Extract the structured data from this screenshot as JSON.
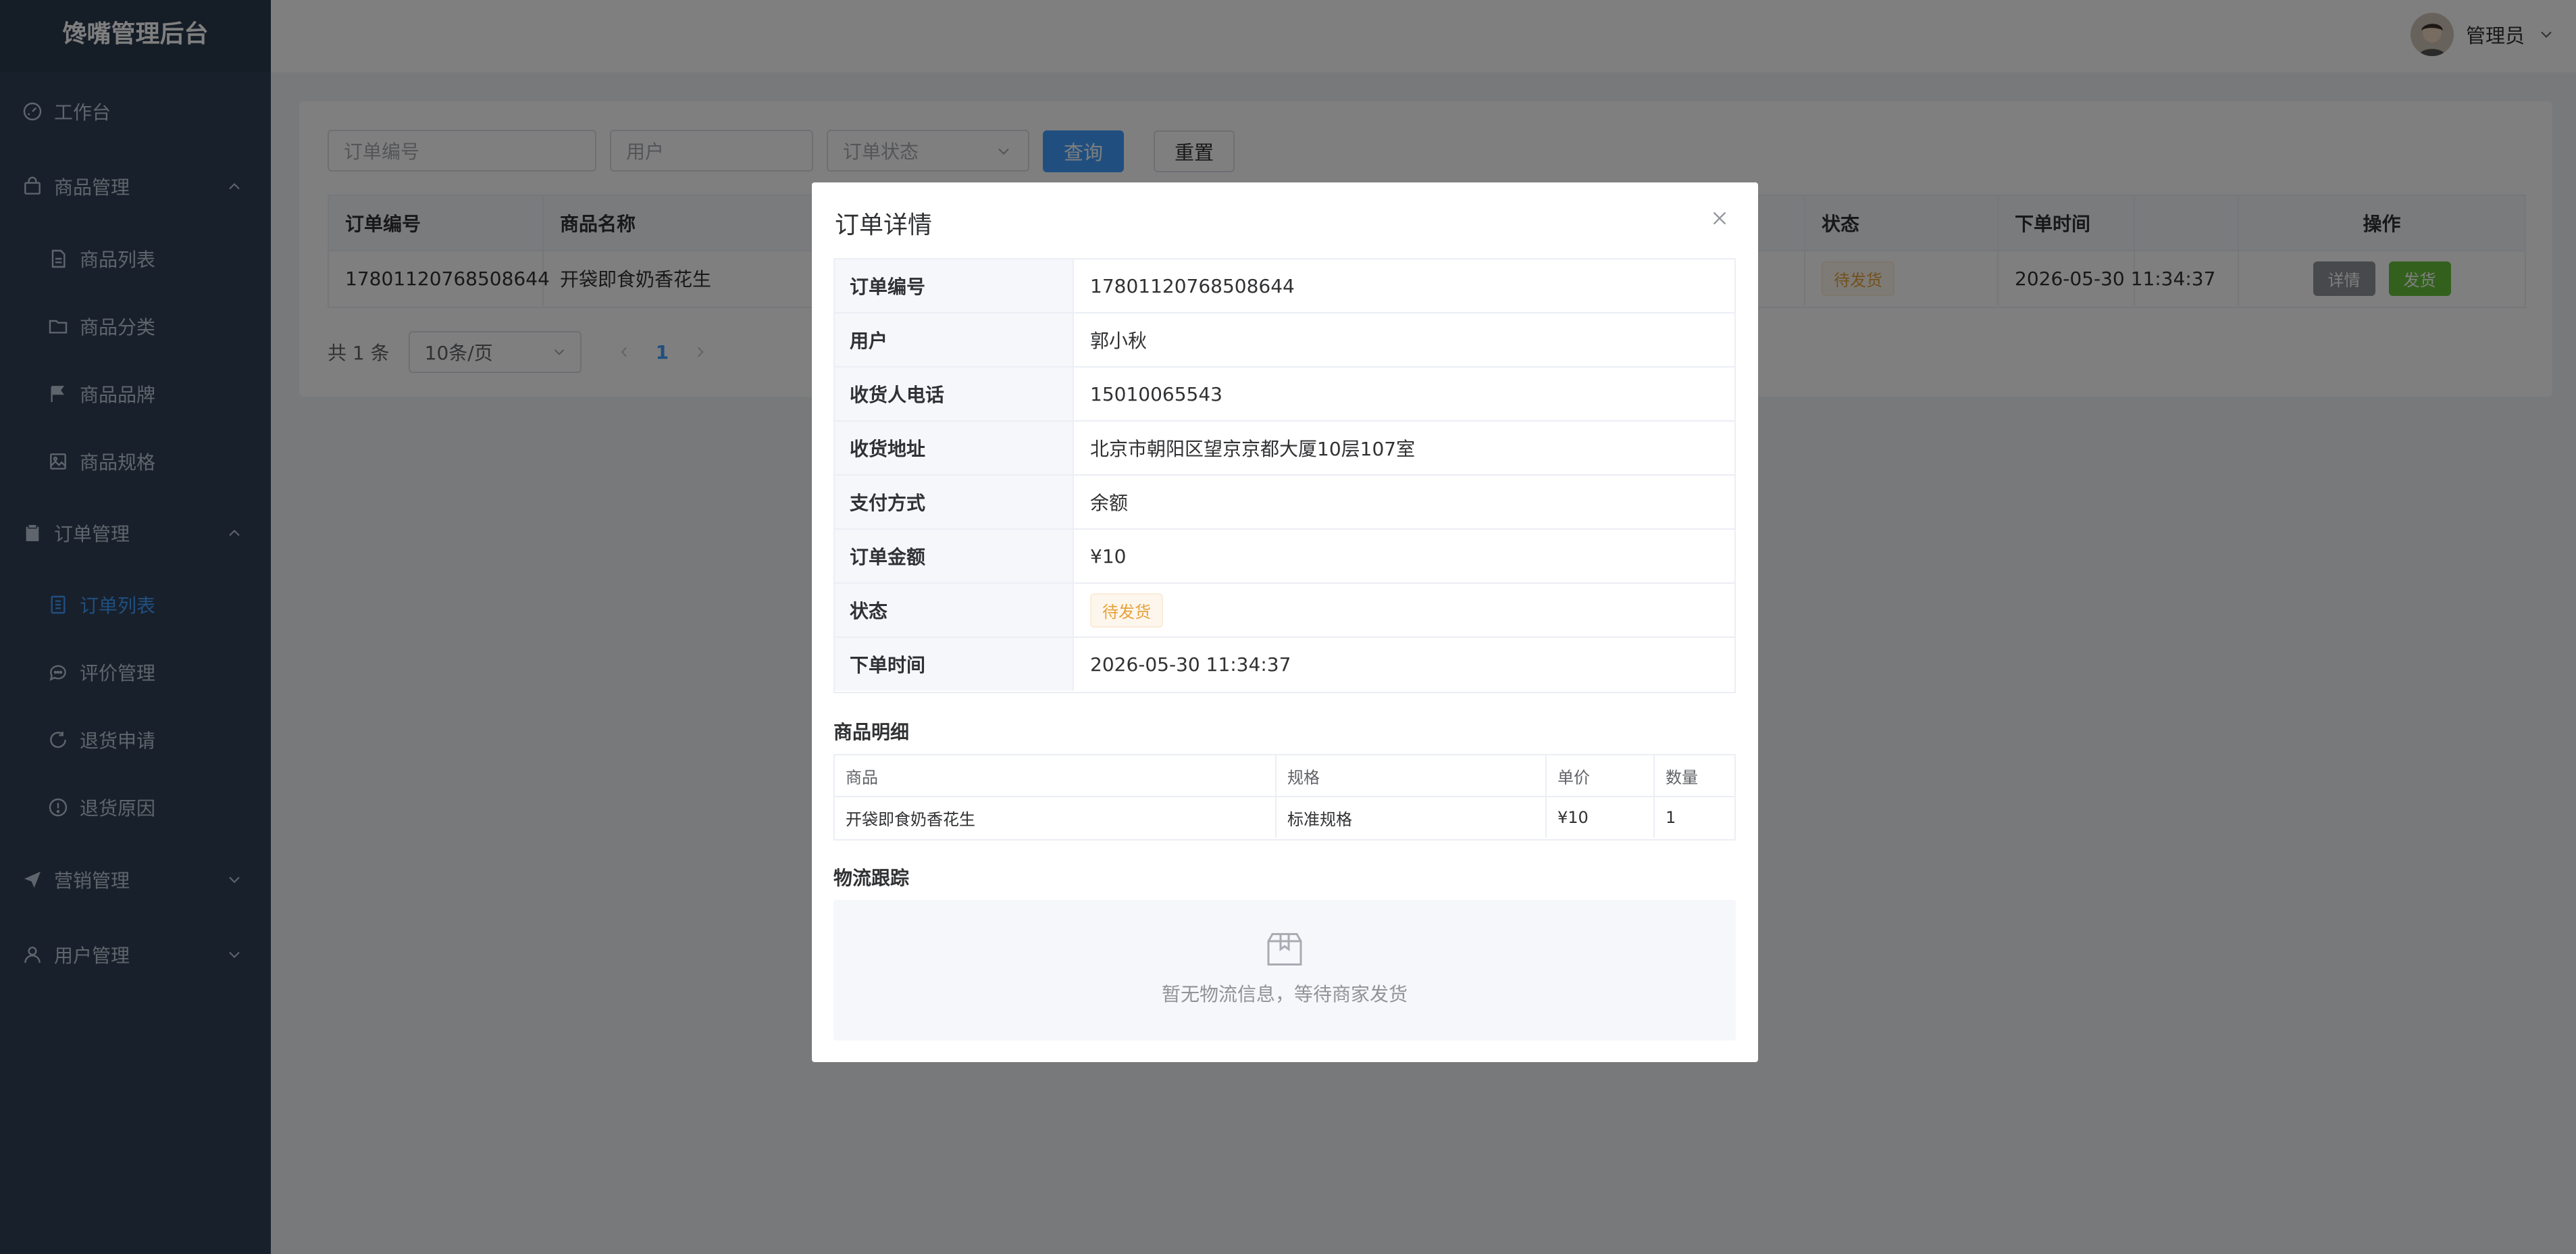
{
  "app": {
    "title": "馋嘴管理后台"
  },
  "sidebar": {
    "items": [
      {
        "label": "工作台",
        "icon": "dashboard-icon"
      },
      {
        "label": "商品管理",
        "icon": "bag-icon",
        "expanded": true
      },
      {
        "label": "商品列表",
        "icon": "document-icon"
      },
      {
        "label": "商品分类",
        "icon": "folder-icon"
      },
      {
        "label": "商品品牌",
        "icon": "flag-icon"
      },
      {
        "label": "商品规格",
        "icon": "picture-icon"
      },
      {
        "label": "订单管理",
        "icon": "clipboard-icon",
        "expanded": true
      },
      {
        "label": "订单列表",
        "icon": "list-icon",
        "active": true
      },
      {
        "label": "评价管理",
        "icon": "chat-icon"
      },
      {
        "label": "退货申请",
        "icon": "refresh-icon"
      },
      {
        "label": "退货原因",
        "icon": "warning-icon"
      },
      {
        "label": "营销管理",
        "icon": "send-icon",
        "expanded": false
      },
      {
        "label": "用户管理",
        "icon": "user-icon",
        "expanded": false
      }
    ]
  },
  "header": {
    "user_name": "管理员"
  },
  "filters": {
    "order_no_placeholder": "订单编号",
    "user_placeholder": "用户",
    "status_placeholder": "订单状态",
    "search_label": "查询",
    "reset_label": "重置"
  },
  "table": {
    "headers": {
      "order_no": "订单编号",
      "product_name": "商品名称",
      "status": "状态",
      "order_time": "下单时间",
      "actions": "操作"
    },
    "rows": [
      {
        "order_no": "17801120768508644",
        "product_name": "开袋即食奶香花生",
        "status": "待发货",
        "order_time": "2026-05-30 11:34:37",
        "detail_label": "详情",
        "ship_label": "发货"
      }
    ]
  },
  "pagination": {
    "total_text": "共 1 条",
    "page_size": "10条/页",
    "current_page": "1"
  },
  "dialog": {
    "title": "订单详情",
    "fields": [
      {
        "label": "订单编号",
        "value": "17801120768508644"
      },
      {
        "label": "用户",
        "value": "郭小秋"
      },
      {
        "label": "收货人电话",
        "value": "15010065543"
      },
      {
        "label": "收货地址",
        "value": "北京市朝阳区望京京都大厦10层107室"
      },
      {
        "label": "支付方式",
        "value": "余额"
      },
      {
        "label": "订单金额",
        "value": "¥10"
      },
      {
        "label": "状态",
        "value": "待发货"
      },
      {
        "label": "下单时间",
        "value": "2026-05-30 11:34:37"
      }
    ],
    "items_title": "商品明细",
    "items_headers": {
      "product": "商品",
      "spec": "规格",
      "price": "单价",
      "qty": "数量"
    },
    "items": [
      {
        "product": "开袋即食奶香花生",
        "spec": "标准规格",
        "price": "¥10",
        "qty": "1"
      }
    ],
    "logistics_title": "物流跟踪",
    "logistics_empty": "暂无物流信息，等待商家发货"
  },
  "colors": {
    "sidebar_bg": "#304156",
    "primary": "#409eff",
    "warning": "#e6a23c",
    "success": "#67c23a",
    "info": "#909399"
  }
}
